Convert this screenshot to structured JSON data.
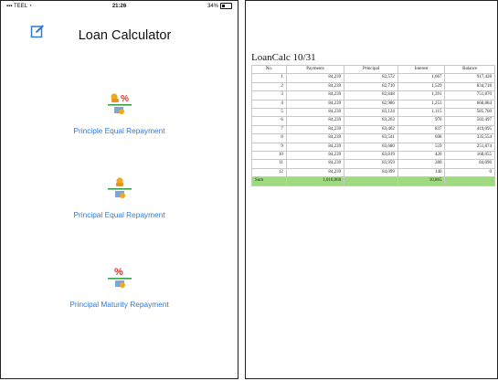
{
  "status_bar": {
    "carrier": "TEEL",
    "time": "21:26",
    "battery": "34%"
  },
  "left_screen": {
    "title": "Loan Calculator",
    "icons": {
      "edit": "edit-icon",
      "option_glyphs": [
        "coins-percent-icon",
        "coins-icon",
        "percent-coins-icon"
      ]
    },
    "options": [
      {
        "label": "Principle Equal Repayment"
      },
      {
        "label": "Principal Equal Repayment"
      },
      {
        "label": "Principal Maturity Repayment"
      }
    ],
    "colors": {
      "link": "#2f7ad6",
      "percent": "#e0302a",
      "coin": "#f0a81c",
      "bar": "#3aa04c"
    }
  },
  "right_screen": {
    "title": "LoanCalc 10/31",
    "columns": [
      "No.",
      "Payments",
      "Principal",
      "Interest",
      "Balance"
    ],
    "rows": [
      [
        "1",
        "84,239",
        "82,572",
        "1,667",
        "917,428"
      ],
      [
        "2",
        "84,239",
        "82,710",
        "1,529",
        "834,718"
      ],
      [
        "3",
        "84,239",
        "82,848",
        "1,391",
        "751,870"
      ],
      [
        "4",
        "84,239",
        "82,986",
        "1,253",
        "668,884"
      ],
      [
        "5",
        "84,239",
        "83,124",
        "1,115",
        "585,760"
      ],
      [
        "6",
        "84,239",
        "83,263",
        "976",
        "502,497"
      ],
      [
        "7",
        "84,239",
        "83,402",
        "837",
        "419,095"
      ],
      [
        "8",
        "84,239",
        "83,541",
        "698",
        "335,554"
      ],
      [
        "9",
        "84,239",
        "83,680",
        "559",
        "251,874"
      ],
      [
        "10",
        "84,239",
        "83,819",
        "420",
        "168,055"
      ],
      [
        "11",
        "84,239",
        "83,959",
        "280",
        "84,096"
      ],
      [
        "12",
        "84,239",
        "84,099",
        "140",
        "0"
      ]
    ],
    "sum_row": [
      "Sum",
      "1,010,868",
      "",
      "10,865",
      ""
    ],
    "colors": {
      "sum_row": "#9edb7f"
    }
  }
}
